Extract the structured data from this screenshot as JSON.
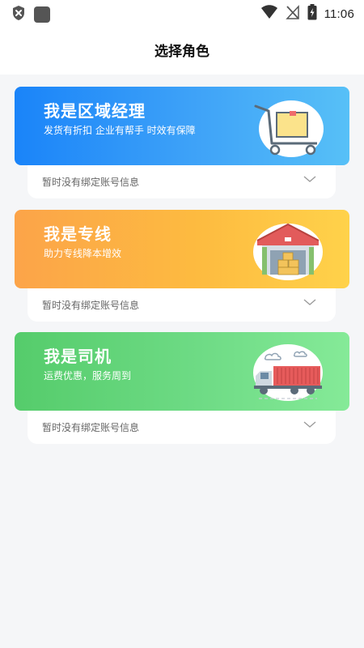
{
  "status_bar": {
    "time": "11:06",
    "icons": [
      "shield-x-icon",
      "app-square-icon",
      "wifi-icon",
      "no-signal-icon",
      "battery-charging-icon"
    ]
  },
  "header": {
    "title": "选择角色"
  },
  "roles": [
    {
      "title": "我是区域经理",
      "subtitle": "发货有折扣 企业有帮手 时效有保障",
      "icon": "hand-truck-icon",
      "account_status": "暂时没有绑定账号信息",
      "expand_icon": "chevron-down-icon",
      "gradient": [
        "#1a84f9",
        "#57c0f7"
      ]
    },
    {
      "title": "我是专线",
      "subtitle": "助力专线降本增效",
      "icon": "warehouse-icon",
      "account_status": "暂时没有绑定账号信息",
      "expand_icon": "chevron-down-icon",
      "gradient": [
        "#fca449",
        "#ffd24a"
      ]
    },
    {
      "title": "我是司机",
      "subtitle": "运费优惠，服务周到",
      "icon": "container-truck-icon",
      "account_status": "暂时没有绑定账号信息",
      "expand_icon": "chevron-down-icon",
      "gradient": [
        "#55cc6b",
        "#85ea98"
      ]
    }
  ]
}
